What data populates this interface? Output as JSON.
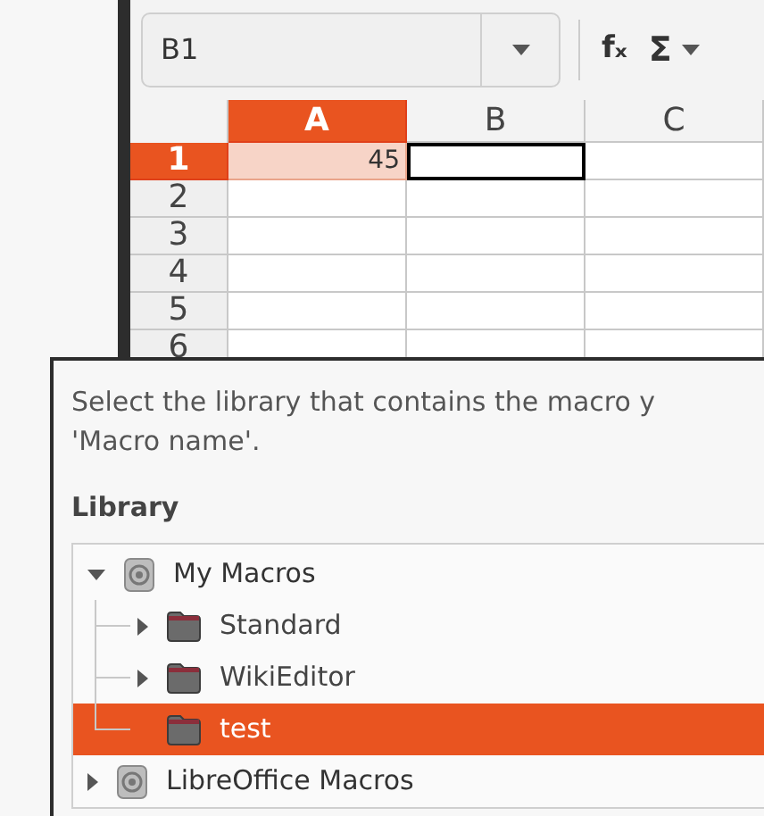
{
  "name_box": {
    "value": "B1"
  },
  "toolbar": {
    "function_label": "fₓ",
    "sum_label": "Σ"
  },
  "sheet": {
    "columns": [
      {
        "label": "A",
        "selected": true
      },
      {
        "label": "B",
        "selected": false
      },
      {
        "label": "C",
        "selected": false
      }
    ],
    "rows": [
      {
        "label": "1",
        "selected": true,
        "cells": [
          {
            "value": "45",
            "highlighted": true,
            "cursor": false
          },
          {
            "highlighted": false,
            "cursor": true
          }
        ]
      },
      {
        "label": "2",
        "selected": false
      },
      {
        "label": "3",
        "selected": false
      },
      {
        "label": "4",
        "selected": false
      },
      {
        "label": "5",
        "selected": false
      },
      {
        "label": "6",
        "selected": false
      }
    ]
  },
  "dialog": {
    "description_lines": [
      "Select the library that contains the macro y",
      "'Macro name'."
    ],
    "library_label": "Library",
    "tree": [
      {
        "label": "My Macros",
        "kind": "container",
        "expanded": true,
        "selected": false,
        "children": [
          {
            "label": "Standard",
            "kind": "library",
            "expandable": true,
            "selected": false
          },
          {
            "label": "WikiEditor",
            "kind": "library",
            "expandable": true,
            "selected": false
          },
          {
            "label": "test",
            "kind": "library",
            "expandable": false,
            "selected": true
          }
        ]
      },
      {
        "label": "LibreOffice Macros",
        "kind": "container",
        "expanded": false,
        "selected": false
      }
    ]
  }
}
